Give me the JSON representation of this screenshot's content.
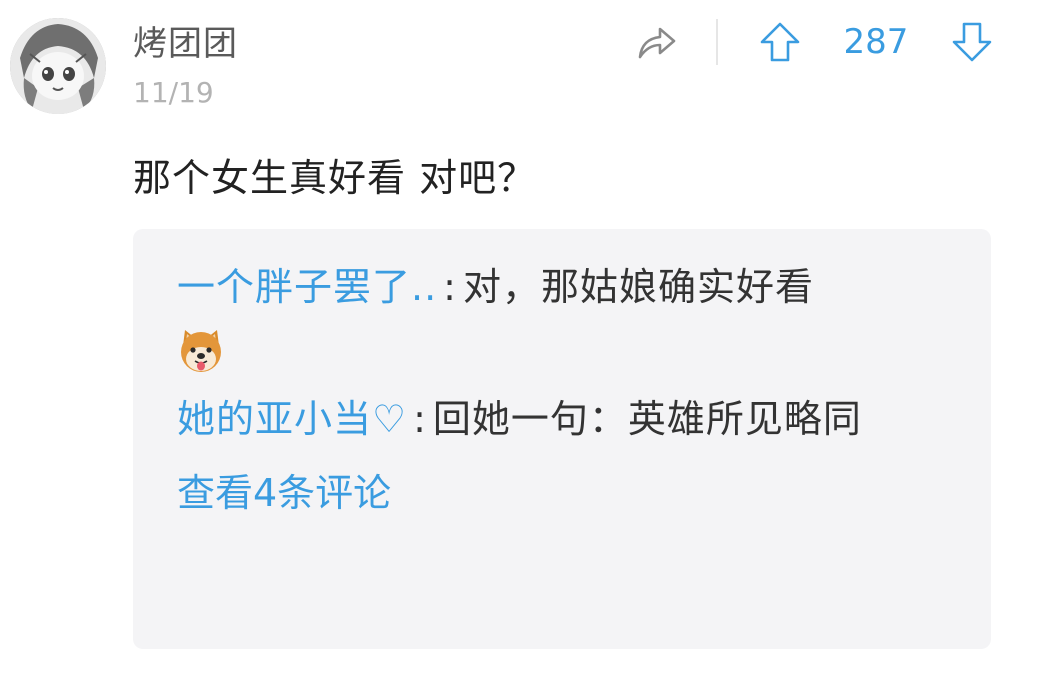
{
  "comment": {
    "username": "烤团团",
    "date": "11/19",
    "text": "那个女生真好看 对吧？",
    "score": "287",
    "icons": {
      "share": "share-icon",
      "upvote": "arrow-up-icon",
      "downvote": "arrow-down-icon",
      "avatar": "anime-avatar"
    }
  },
  "replies": [
    {
      "author": "一个胖子罢了..",
      "separator": ":",
      "text": "对，那姑娘确实好看",
      "emoji": "doge-face-emoji"
    },
    {
      "author": "她的亚小当♡",
      "separator": ":",
      "text": "回她一句：英雄所见略同"
    }
  ],
  "view_more_label": "查看4条评论",
  "colors": {
    "accent": "#3a9ce0",
    "reply_bg": "#f4f4f6",
    "username": "#5a5a5a",
    "date": "#b3b3b3",
    "text": "#222222"
  }
}
